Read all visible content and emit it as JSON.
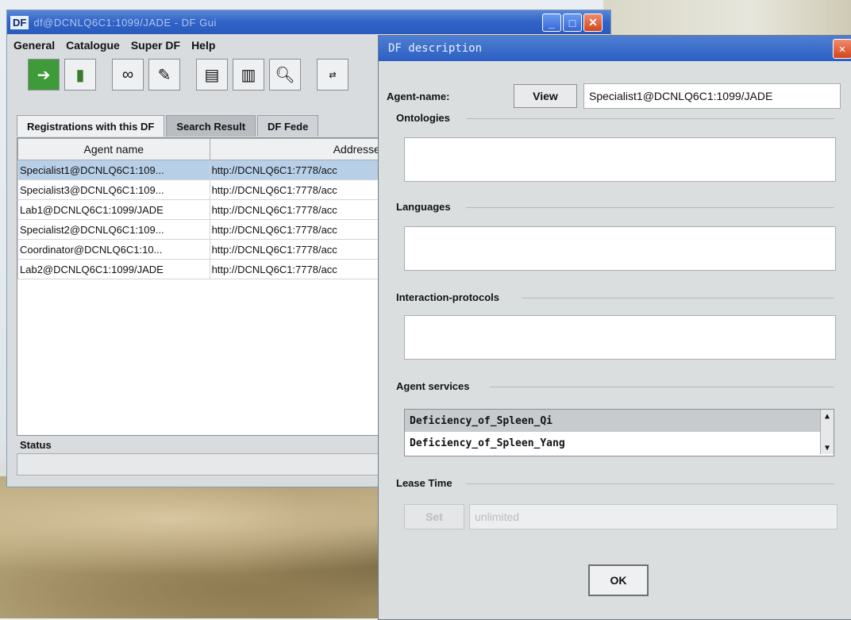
{
  "window": {
    "app_tag": "DF",
    "title": "df@DCNLQ6C1:1099/JADE - DF Gui",
    "buttons": {
      "minimize": "_",
      "maximize": "□",
      "close": "✕"
    }
  },
  "menu": [
    "General",
    "Catalogue",
    "Super DF",
    "Help"
  ],
  "toolbar": {
    "icons": [
      "exit-icon",
      "door-icon",
      "view-icon",
      "modify-icon",
      "register-icon",
      "deregister-icon",
      "search-icon",
      "federate-icon"
    ]
  },
  "tabs": [
    "Registrations with this DF",
    "Search Result",
    "DF Fede"
  ],
  "table": {
    "headers": [
      "Agent name",
      "Addresses"
    ],
    "rows": [
      [
        "Specialist1@DCNLQ6C1:109...",
        "http://DCNLQ6C1:7778/acc"
      ],
      [
        "Specialist3@DCNLQ6C1:109...",
        "http://DCNLQ6C1:7778/acc"
      ],
      [
        "Lab1@DCNLQ6C1:1099/JADE",
        "http://DCNLQ6C1:7778/acc"
      ],
      [
        "Specialist2@DCNLQ6C1:109...",
        "http://DCNLQ6C1:7778/acc"
      ],
      [
        "Coordinator@DCNLQ6C1:10...",
        "http://DCNLQ6C1:7778/acc"
      ],
      [
        "Lab2@DCNLQ6C1:1099/JADE",
        "http://DCNLQ6C1:7778/acc"
      ]
    ]
  },
  "status": {
    "label": "Status"
  },
  "dialog": {
    "title": "DF description",
    "close": "✕",
    "agent_label": "Agent-name:",
    "view_label": "View",
    "agent_value": "Specialist1@DCNLQ6C1:1099/JADE",
    "ontologies_label": "Ontologies",
    "languages_label": "Languages",
    "protocols_label": "Interaction-protocols",
    "services_label": "Agent services",
    "services": [
      "Deficiency_of_Spleen_Qi",
      "Deficiency_of_Spleen_Yang"
    ],
    "lease_label": "Lease Time",
    "set_label": "Set",
    "lease_value": "unlimited",
    "ok_label": "OK"
  }
}
